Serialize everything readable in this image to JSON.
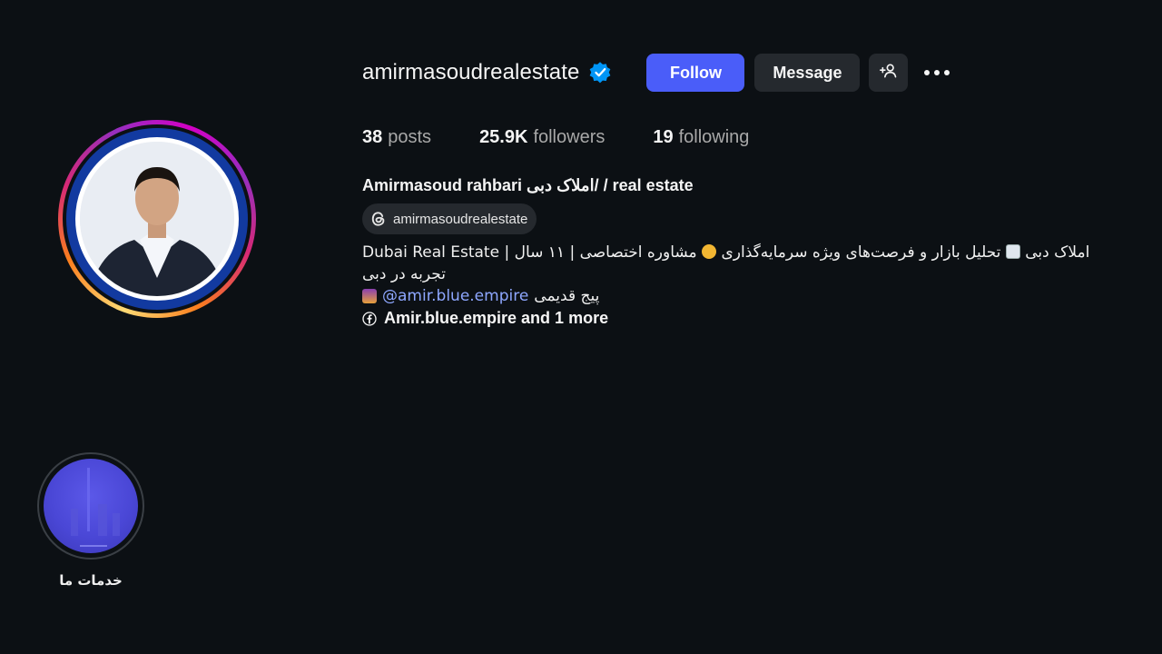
{
  "profile": {
    "username": "amirmasoudrealestate",
    "verified": true,
    "full_name": "Amirmasoud rahbari املاک دبی/ / real estate",
    "threads_handle": "amirmasoudrealestate"
  },
  "actions": {
    "follow_label": "Follow",
    "message_label": "Message"
  },
  "stats": {
    "posts_count": "38",
    "posts_label": "posts",
    "followers_count": "25.9K",
    "followers_label": "followers",
    "following_count": "19",
    "following_label": "following"
  },
  "bio": {
    "line1_a": "املاک دبی",
    "line1_b": "تحلیل بازار و فرصت‌های ویژه سرمایه‌گذاری",
    "line1_c": "مشاوره اختصاصی | ۱۱ سال | Dubai Real Estate",
    "line2": "تجربه در دبی",
    "line3_mention": "@amir.blue.empire",
    "line3_text": "پیج قدیمی"
  },
  "links": {
    "text": "Amir.blue.empire and 1 more"
  },
  "highlights": [
    {
      "label": "خدمات ما"
    }
  ],
  "colors": {
    "background": "#0c1014",
    "follow_button": "#4a5df9",
    "secondary_button": "#25292e",
    "verified_badge": "#0095f6",
    "mention": "#8ea7ff"
  },
  "icons": {
    "verified": "verified-badge-icon",
    "add_user": "add-user-icon",
    "more": "more-options-icon",
    "threads": "threads-icon",
    "link": "facebook-icon"
  }
}
